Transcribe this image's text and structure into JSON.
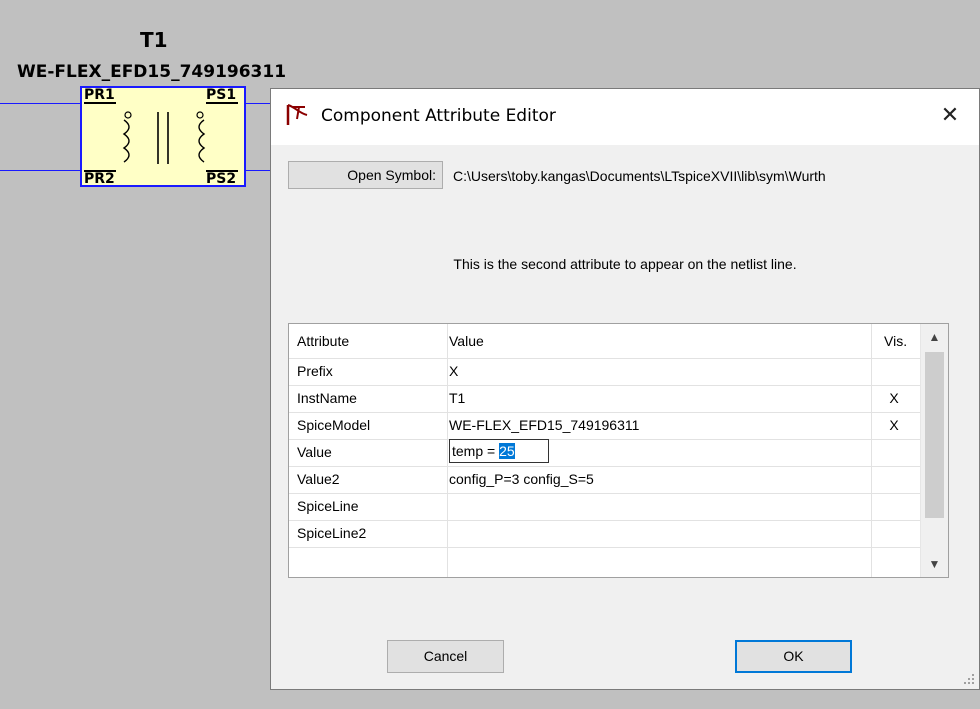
{
  "schematic": {
    "inst_name": "T1",
    "model_name": "WE-FLEX_EFD15_749196311",
    "pins": {
      "pr1": "PR1",
      "ps1": "PS1",
      "pr2": "PR2",
      "ps2": "PS2"
    },
    "wire_color": "#1a1aff",
    "body_color": "#ffffc6"
  },
  "dialog": {
    "title": "Component Attribute Editor",
    "title_icon": "ltspice-logo-icon",
    "close_label": "✕",
    "open_symbol_label": "Open Symbol:",
    "symbol_path": "C:\\Users\\toby.kangas\\Documents\\LTspiceXVII\\lib\\sym\\Wurth",
    "description": "This is the second attribute to appear on the netlist line.",
    "grid": {
      "headers": {
        "attribute": "Attribute",
        "value": "Value",
        "vis": "Vis."
      },
      "rows": [
        {
          "attribute": "Prefix",
          "value": "X",
          "vis": ""
        },
        {
          "attribute": "InstName",
          "value": "T1",
          "vis": "X"
        },
        {
          "attribute": "SpiceModel",
          "value": "WE-FLEX_EFD15_749196311",
          "vis": "X"
        },
        {
          "attribute": "Value",
          "value": "",
          "vis": ""
        },
        {
          "attribute": "Value2",
          "value": "config_P=3 config_S=5",
          "vis": ""
        },
        {
          "attribute": "SpiceLine",
          "value": "",
          "vis": ""
        },
        {
          "attribute": "SpiceLine2",
          "value": "",
          "vis": ""
        }
      ],
      "edit": {
        "prefix_text": "temp = ",
        "selected_text": "25"
      }
    },
    "cancel_label": "Cancel",
    "ok_label": "OK"
  }
}
